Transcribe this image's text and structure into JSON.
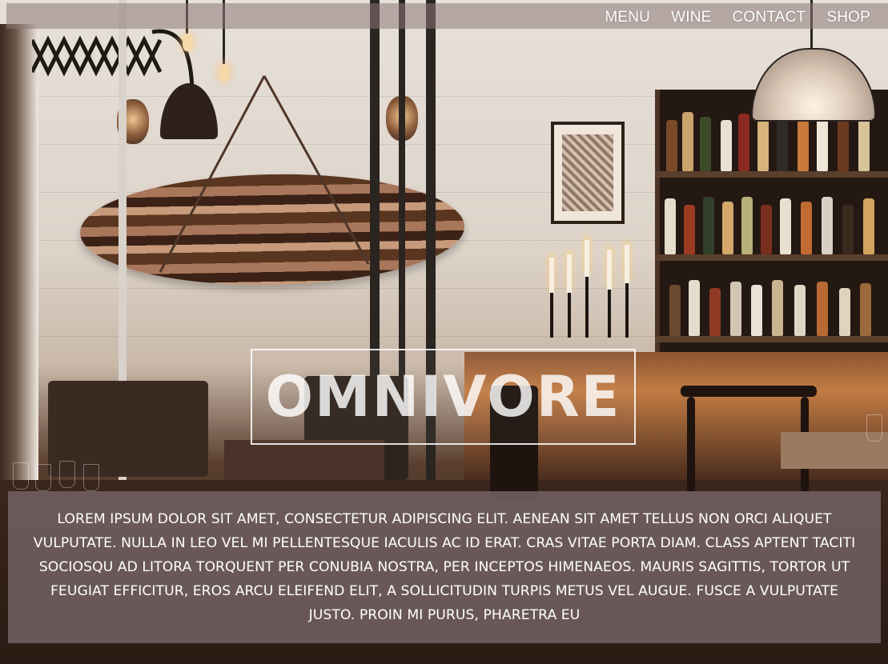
{
  "nav": {
    "items": [
      "MENU",
      "WINE",
      "CONTACT",
      "SHOP"
    ]
  },
  "logo": {
    "text": "OMNIVORE"
  },
  "description": {
    "text": "LOREM IPSUM DOLOR SIT AMET, CONSECTETUR ADIPISCING ELIT. AENEAN SIT AMET TELLUS NON ORCI ALIQUET VULPUTATE. NULLA IN LEO VEL MI PELLENTESQUE IACULIS AC ID ERAT. CRAS VITAE PORTA DIAM. CLASS APTENT TACITI SOCIOSQU AD LITORA TORQUENT PER CONUBIA NOSTRA, PER INCEPTOS HIMENAEOS. MAURIS SAGITTIS, TORTOR UT FEUGIAT EFFICITUR, EROS ARCU ELEIFEND ELIT, A SOLLICITUDIN TURPIS METUS VEL AUGUE. FUSCE A VULPUTATE JUSTO. PROIN MI PURUS, PHARETRA EU"
  },
  "colors": {
    "nav_overlay": "#8c7876",
    "panel_overlay": "#7a686c",
    "text": "#ffffff"
  }
}
